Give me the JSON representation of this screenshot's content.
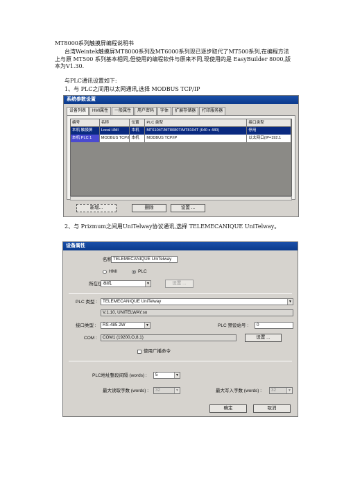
{
  "doc": {
    "title": "MT8000系列触摸屏编程说明书",
    "intro": "台湾Weintek触摸屏MT8000系列及MT6000系列现已逐步取代了MT500系列,在编程方法上与原 MT500 系列基本相同,但使用的编程软件与原来不同,现使用的是 EasyBuilder 8000,版本为V1.30.",
    "plc_setting": "与PLC通讯设置如下:",
    "step1": "1、与 PLC之间用以太网通讯,选择 MODBUS TCP/IP",
    "step2": "2、与 Prizmum之间用UniTelway协议通讯,选择 TELEMECANIQUE UniTelway。"
  },
  "dialog1": {
    "title": "系统参数设置",
    "tabs": [
      "设备列表",
      "HMI属性",
      "一般属性",
      "用户密码",
      "字体",
      "扩展存储器",
      "打印服务器"
    ],
    "columns": [
      "编号",
      "名称",
      "位置",
      "PLC 类型",
      "接口类型"
    ],
    "rows": [
      [
        "本机 触摸屏",
        "Local HMI",
        "本机",
        "MT6104T/MT8080T/MT8104T (640 x 480)",
        "停用"
      ],
      [
        "本机 PLC 1",
        "MODBUS TCP/IP",
        "本机",
        "MODBUS TCP/IP",
        "以太网口(IP=192.1"
      ]
    ],
    "buttons": {
      "add": "新增...",
      "delete": "删除",
      "settings": "设置 ..."
    }
  },
  "dialog2": {
    "title": "设备属性",
    "name_label": "名称 :",
    "name_value": "TELEMECANIQUE UniTelway",
    "radio_hmi": "HMI",
    "radio_plc": "PLC",
    "location_label": "所在位置 :",
    "location_value": "本机",
    "location_settings": "设置 ...",
    "plc_type_label": "PLC 类型 :",
    "plc_type_value": "TELEMECANIQUE UniTelway",
    "driver_info": "V.1.10, UNITELWAY.so",
    "interface_label": "接口类型 :",
    "interface_value": "RS-485 2W",
    "station_label": "PLC 预设站号 :",
    "station_value": "0",
    "com_label": "COM :",
    "com_value": "COM1 (19200,O,8,1)",
    "com_settings": "设置 ...",
    "broadcast_label": "使用广播命令",
    "interval_label": "PLC地址整段间隔 (words) :",
    "interval_value": "5",
    "max_read_label": "最大读取字数 (words) :",
    "max_read_value": "32",
    "max_write_label": "最大写入字数 (words) :",
    "max_write_value": "32",
    "ok": "确定",
    "cancel": "取消"
  }
}
